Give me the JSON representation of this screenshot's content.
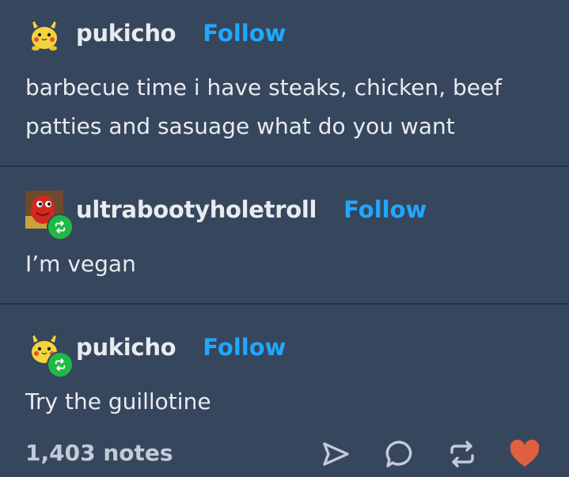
{
  "posts": [
    {
      "username": "pukicho",
      "follow_label": "Follow",
      "avatar_icon": "pikachu-plush-icon",
      "lines": [
        "barbecue time i have steaks, chicken, beef",
        "patties and sasuage what do you want"
      ]
    },
    {
      "username": "ultrabootyholetroll",
      "follow_label": "Follow",
      "avatar_icon": "red-character-icon",
      "badge_icon": "reblog-icon",
      "lines": [
        "I’m vegan"
      ]
    },
    {
      "username": "pukicho",
      "follow_label": "Follow",
      "avatar_icon": "pikachu-plush-icon",
      "badge_icon": "reblog-icon",
      "lines": [
        "Try the guillotine"
      ]
    }
  ],
  "footer": {
    "notes": "1,403 notes",
    "actions": [
      "share-icon",
      "comment-icon",
      "reblog-icon",
      "like-heart-icon"
    ]
  },
  "colors": {
    "background": "#36465d",
    "divider": "#23344a",
    "text": "#e8ebf0",
    "follow": "#1fa8ff",
    "reblog_badge": "#1fba46",
    "like": "#e0603e"
  }
}
